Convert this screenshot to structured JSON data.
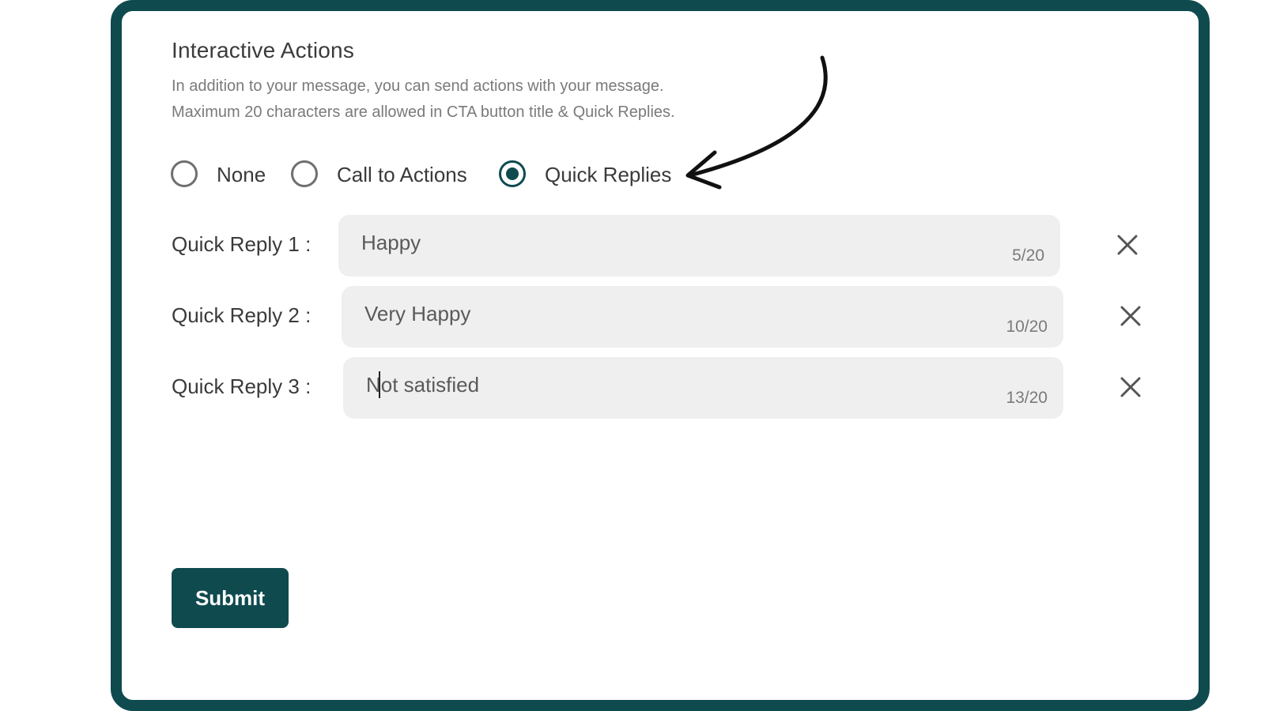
{
  "section": {
    "title": "Interactive Actions",
    "description_line1": "In addition to your message, you can send actions with your message.",
    "description_line2": "Maximum 20 characters are allowed in CTA button title & Quick Replies."
  },
  "action_type": {
    "options": [
      "None",
      "Call to Actions",
      "Quick Replies"
    ],
    "selected": "Quick Replies"
  },
  "quick_replies": [
    {
      "label": "Quick Reply 1 :",
      "value": "Happy",
      "count": "5/20"
    },
    {
      "label": "Quick Reply 2 :",
      "value": "Very Happy",
      "count": "10/20"
    },
    {
      "label": "Quick Reply 3 :",
      "value": "Not satisfied",
      "count": "13/20"
    }
  ],
  "submit_label": "Submit",
  "colors": {
    "brand": "#0f4a4f",
    "field_background": "#efefef",
    "annotation_arrow": "#111111"
  },
  "icons": {
    "remove": "close-icon",
    "annotation": "curved-arrow-icon"
  }
}
